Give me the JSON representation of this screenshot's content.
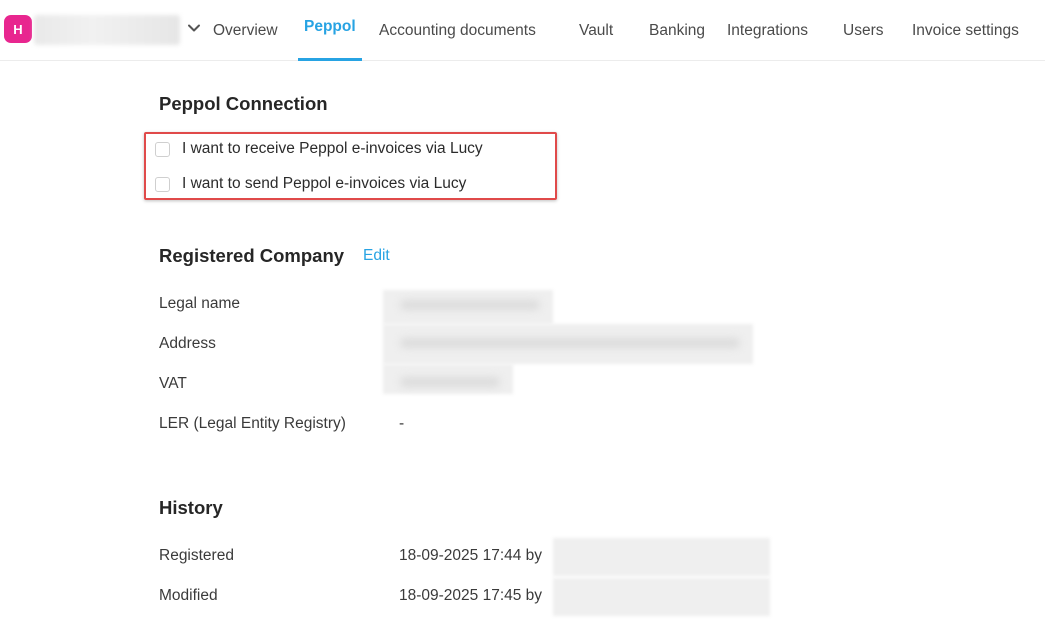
{
  "org": {
    "badge_letter": "H",
    "badge_color": "#e8268f"
  },
  "nav": {
    "tabs": [
      {
        "label": "Overview",
        "active": false
      },
      {
        "label": "Peppol",
        "active": true
      },
      {
        "label": "Accounting documents",
        "active": false
      },
      {
        "label": "Vault",
        "active": false
      },
      {
        "label": "Banking",
        "active": false
      },
      {
        "label": "Integrations",
        "active": false
      },
      {
        "label": "Users",
        "active": false
      },
      {
        "label": "Invoice settings",
        "active": false
      }
    ],
    "accent_color": "#27a3e3"
  },
  "peppol_connection": {
    "title": "Peppol Connection",
    "options": [
      {
        "label": "I want to receive Peppol e-invoices via Lucy",
        "checked": false
      },
      {
        "label": "I want to send Peppol e-invoices via Lucy",
        "checked": false
      }
    ]
  },
  "registered_company": {
    "title": "Registered Company",
    "edit_label": "Edit",
    "fields": [
      {
        "label": "Legal name",
        "value": ""
      },
      {
        "label": "Address",
        "value": ""
      },
      {
        "label": "VAT",
        "value": ""
      },
      {
        "label": "LER (Legal Entity Registry)",
        "value": "-"
      }
    ]
  },
  "history": {
    "title": "History",
    "entries": [
      {
        "label": "Registered",
        "value": "18-09-2025 17:44 by"
      },
      {
        "label": "Modified",
        "value": "18-09-2025 17:45 by"
      }
    ]
  }
}
